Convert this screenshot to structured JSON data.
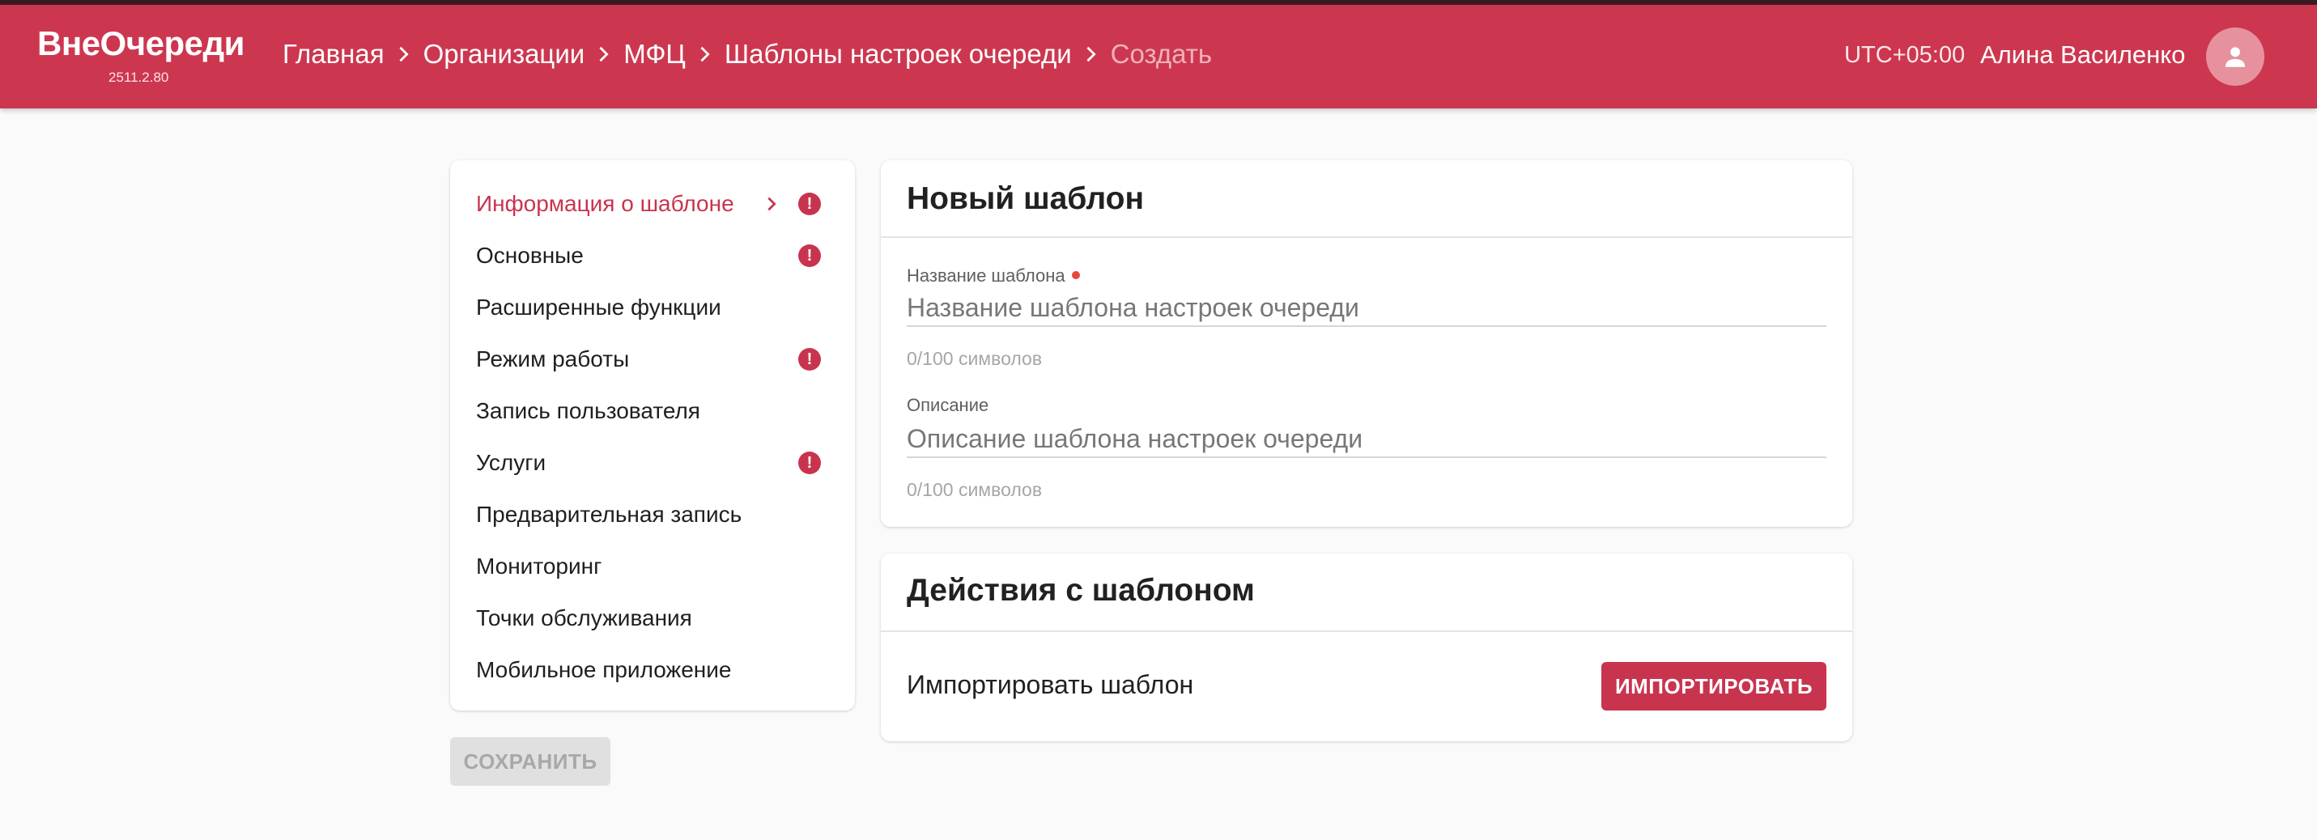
{
  "header": {
    "brand": "ВнеОчереди",
    "version": "2511.2.80",
    "breadcrumbs": [
      "Главная",
      "Организации",
      "МФЦ",
      "Шаблоны настроек очереди",
      "Создать"
    ],
    "timezone": "UTC+05:00",
    "user_name": "Алина Василенко"
  },
  "sidebar": {
    "items": [
      {
        "label": "Информация о шаблоне",
        "active": true,
        "alert": true
      },
      {
        "label": "Основные",
        "active": false,
        "alert": true
      },
      {
        "label": "Расширенные функции",
        "active": false,
        "alert": false
      },
      {
        "label": "Режим работы",
        "active": false,
        "alert": true
      },
      {
        "label": "Запись пользователя",
        "active": false,
        "alert": false
      },
      {
        "label": "Услуги",
        "active": false,
        "alert": true
      },
      {
        "label": "Предварительная запись",
        "active": false,
        "alert": false
      },
      {
        "label": "Мониторинг",
        "active": false,
        "alert": false
      },
      {
        "label": "Точки обслуживания",
        "active": false,
        "alert": false
      },
      {
        "label": "Мобильное приложение",
        "active": false,
        "alert": false
      }
    ],
    "alert_glyph": "!"
  },
  "save_button": "СОХРАНИТЬ",
  "template_card": {
    "title": "Новый шаблон",
    "name_field": {
      "label": "Название шаблона",
      "value": "",
      "placeholder": "Название шаблона настроек очереди",
      "hint": "0/100 символов"
    },
    "description_field": {
      "label": "Описание",
      "value": "",
      "placeholder": "Описание шаблона настроек очереди",
      "hint": "0/100 символов"
    }
  },
  "actions_card": {
    "title": "Действия с шаблоном",
    "import_label": "Импортировать шаблон",
    "import_button": "ИМПОРТИРОВАТЬ"
  },
  "colors": {
    "brand": "#cc374f",
    "accent": "#c8344e",
    "required_dot": "#e4483a"
  },
  "icons": {
    "breadcrumb_separator": "chevron-right-icon",
    "nav_active": "chevron-right-icon",
    "nav_alert": "alert-icon",
    "avatar": "person-icon"
  }
}
